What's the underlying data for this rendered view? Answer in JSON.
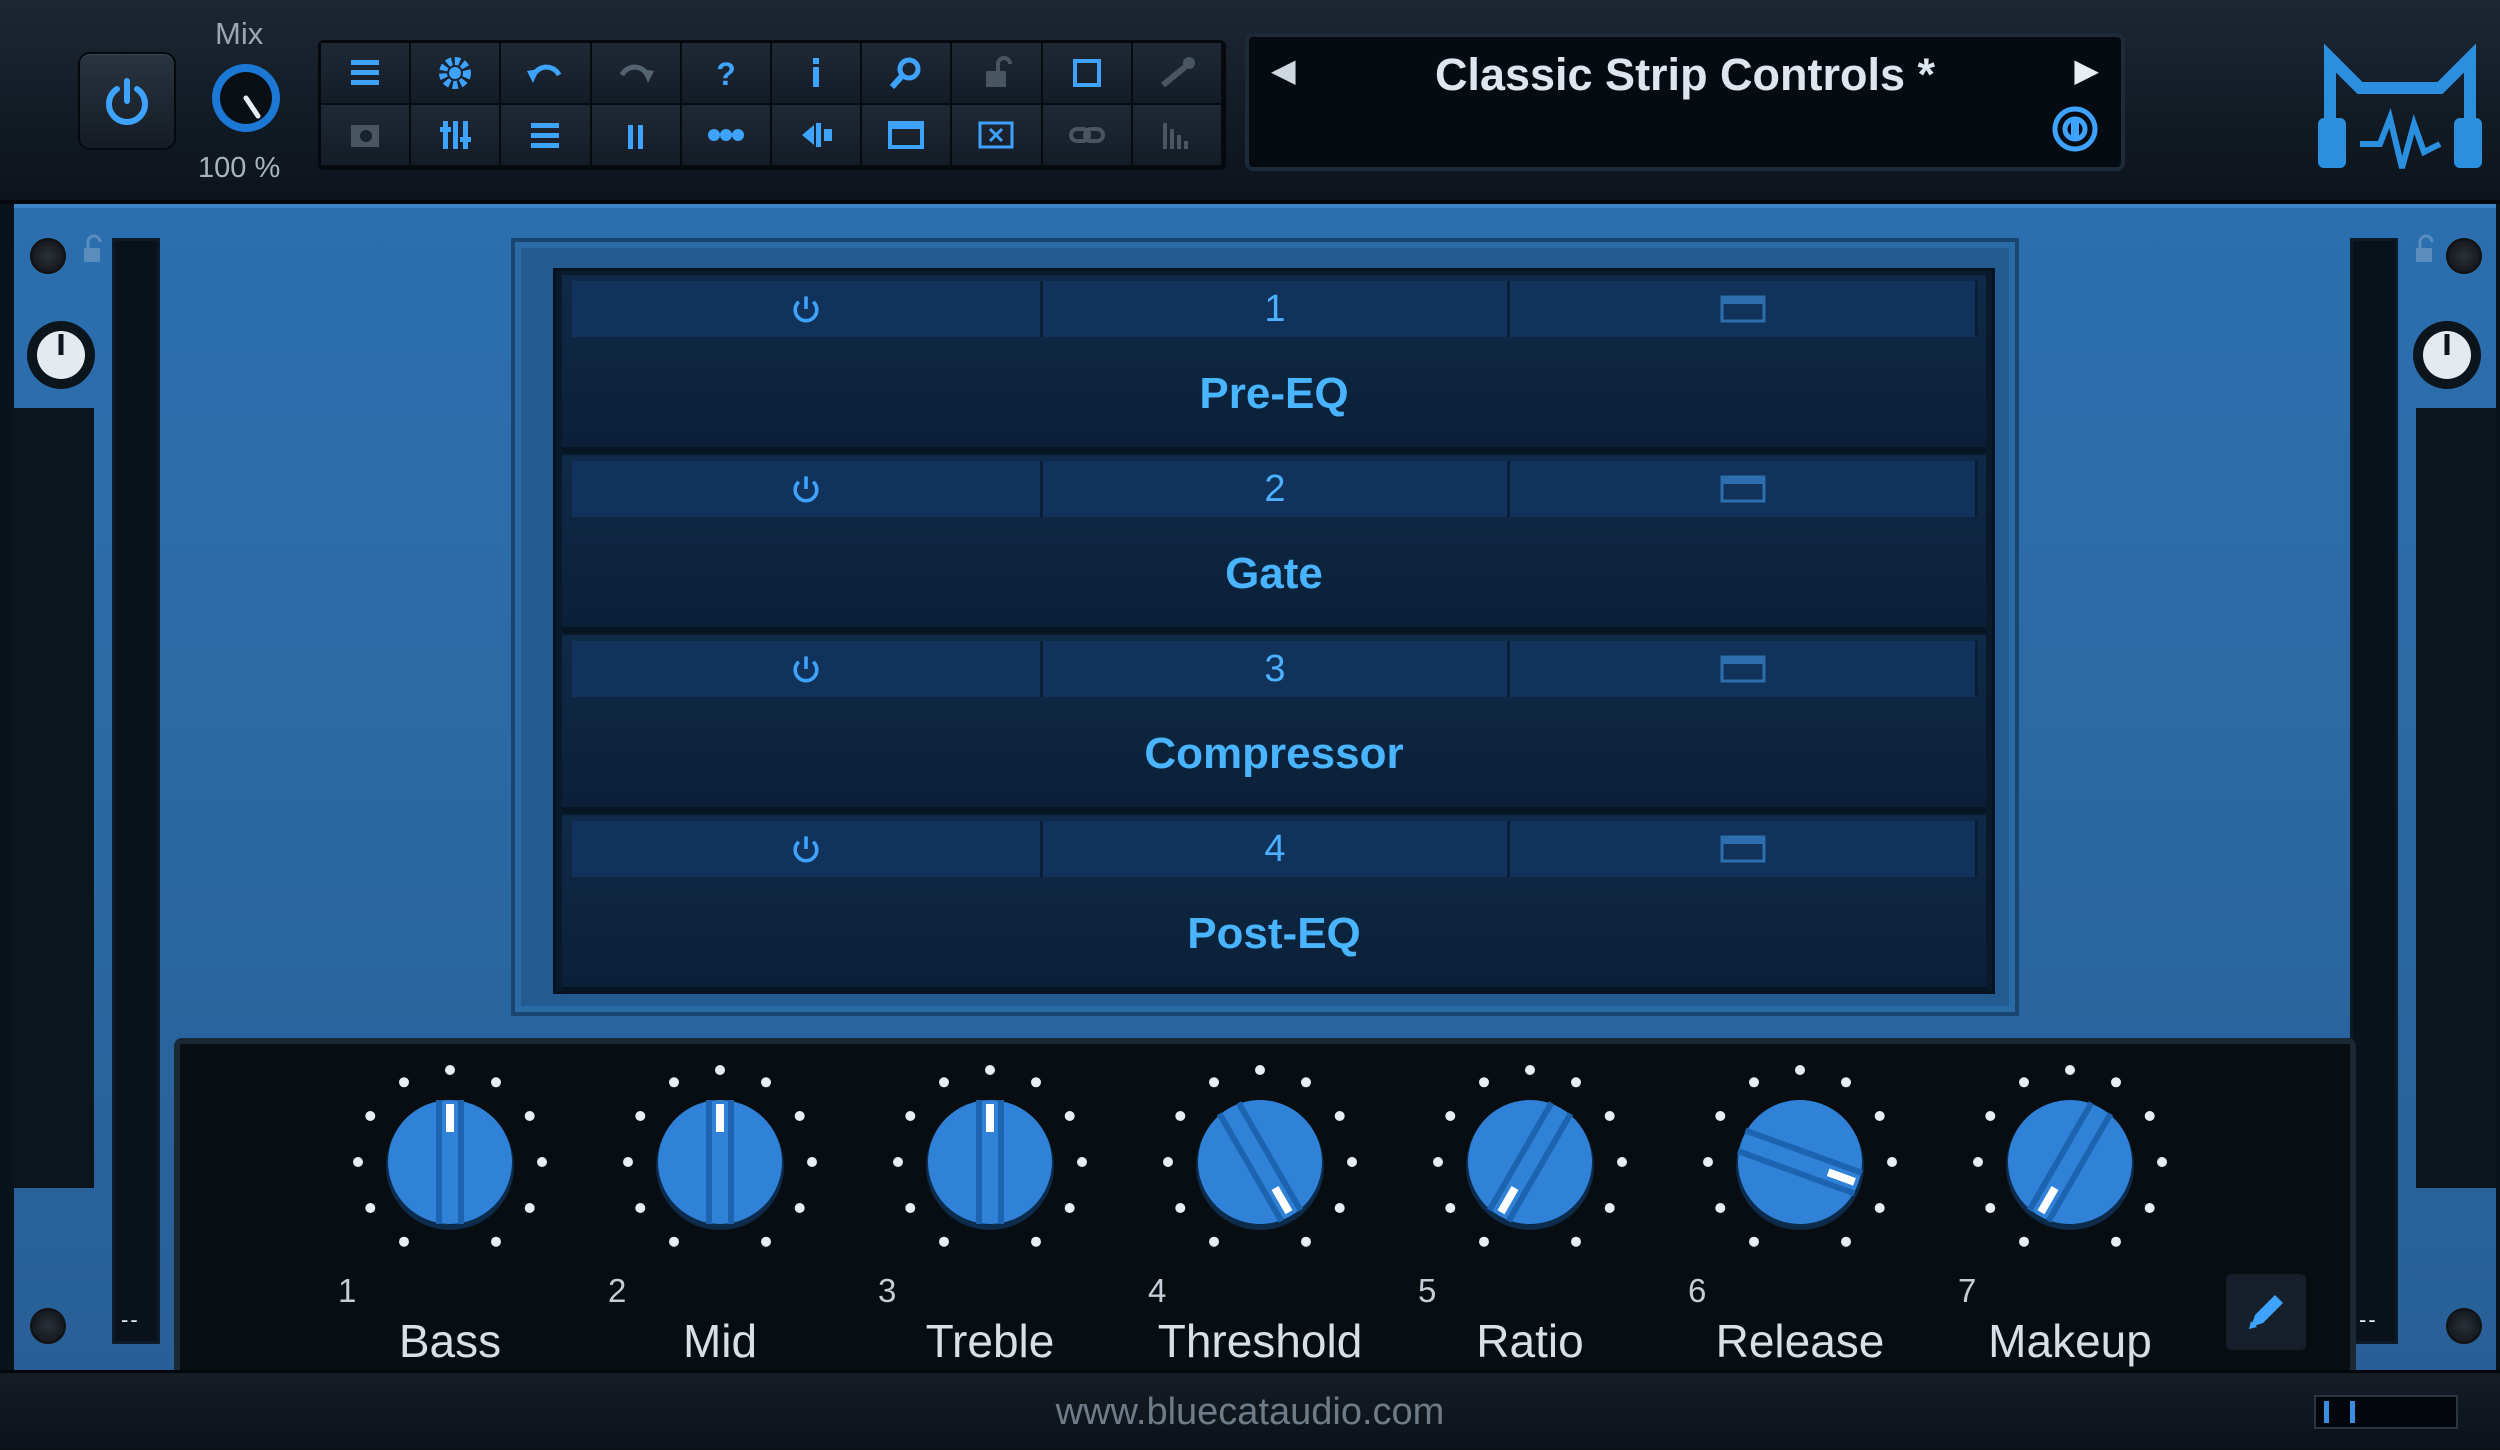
{
  "app": {
    "title": "Classic Strip Controls *"
  },
  "mix": {
    "label": "Mix",
    "value": "100 %"
  },
  "toolbar": {
    "row1": [
      "menu-icon",
      "gear-icon",
      "undo-icon",
      "redo-icon",
      "help-icon",
      "info-icon",
      "search-icon",
      "lock-icon",
      "window-icon",
      "wrench-icon"
    ],
    "row2": [
      "presets-browser-icon",
      "sliders-icon",
      "grid-icon",
      "meters-icon",
      "chain-icon",
      "midi-icon",
      "editor-window-icon",
      "close-window-icon",
      "link-icon",
      "analyzer-icon"
    ]
  },
  "preset": {
    "name": "Classic Strip Controls *",
    "prev": "◀",
    "next": "▶"
  },
  "slots": [
    {
      "index": "1",
      "name": "Pre-EQ"
    },
    {
      "index": "2",
      "name": "Gate"
    },
    {
      "index": "3",
      "name": "Compressor"
    },
    {
      "index": "4",
      "name": "Post-EQ"
    }
  ],
  "knobs": [
    {
      "index": "1",
      "label": "Bass",
      "angle": 0
    },
    {
      "index": "2",
      "label": "Mid",
      "angle": 0
    },
    {
      "index": "3",
      "label": "Treble",
      "angle": 0
    },
    {
      "index": "4",
      "label": "Threshold",
      "angle": 150
    },
    {
      "index": "5",
      "label": "Ratio",
      "angle": -150
    },
    {
      "index": "6",
      "label": "Release",
      "angle": 110
    },
    {
      "index": "7",
      "label": "Makeup",
      "angle": -150
    }
  ],
  "footer": {
    "url": "www.bluecataudio.com"
  },
  "side": {
    "left_dash": "--",
    "right_dash": "--"
  },
  "colors": {
    "accent": "#49b4ff",
    "panel": "#2b6fb0",
    "knob": "#2f82d8"
  }
}
